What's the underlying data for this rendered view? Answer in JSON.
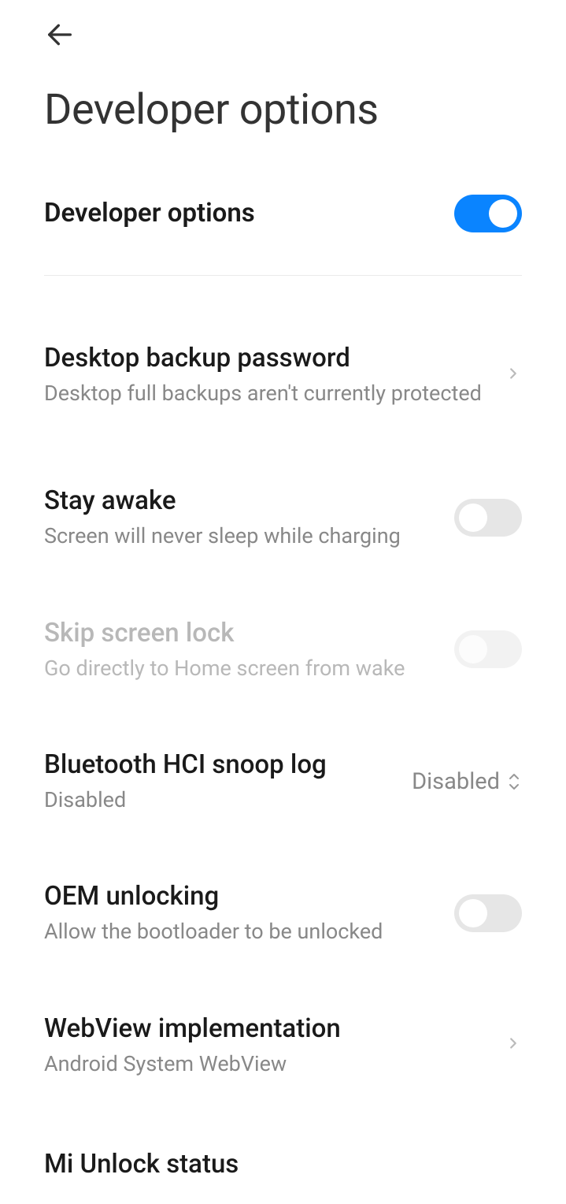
{
  "header": {
    "title": "Developer options"
  },
  "master": {
    "title": "Developer options",
    "enabled": true
  },
  "items": [
    {
      "key": "desktop-backup",
      "title": "Desktop backup password",
      "subtitle": "Desktop full backups aren't currently protected",
      "type": "nav"
    },
    {
      "key": "stay-awake",
      "title": "Stay awake",
      "subtitle": "Screen will never sleep while charging",
      "type": "toggle",
      "value": false
    },
    {
      "key": "skip-screen-lock",
      "title": "Skip screen lock",
      "subtitle": "Go directly to Home screen from wake",
      "type": "toggle",
      "value": false,
      "disabled": true
    },
    {
      "key": "bt-hci-snoop",
      "title": "Bluetooth HCI snoop log",
      "subtitle": "Disabled",
      "type": "select",
      "value": "Disabled"
    },
    {
      "key": "oem-unlocking",
      "title": "OEM unlocking",
      "subtitle": "Allow the bootloader to be unlocked",
      "type": "toggle",
      "value": false
    },
    {
      "key": "webview-impl",
      "title": "WebView implementation",
      "subtitle": "Android System WebView",
      "type": "nav"
    },
    {
      "key": "mi-unlock",
      "title": "Mi Unlock status",
      "subtitle": "",
      "type": "nav"
    }
  ]
}
